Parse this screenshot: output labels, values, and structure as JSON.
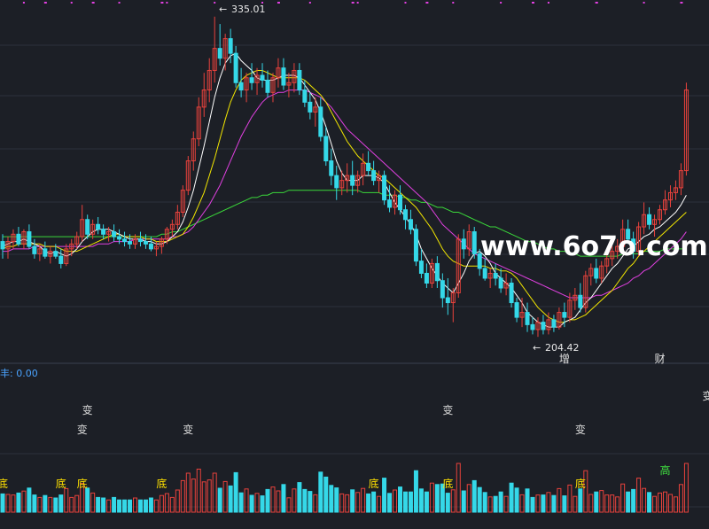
{
  "colors": {
    "background": "#1c1f26",
    "grid": "#2c313c",
    "up": "#e8423c",
    "down": "#35d8e8",
    "ma5": "#ffffff",
    "ma10": "#f2e600",
    "ma20": "#e040e0",
    "ma60": "#3ad83a",
    "divider": "#3a4150",
    "signal_text": "#d8d8d8",
    "low_text": "#ffe100",
    "high_text": "#40e040",
    "watermark": "#ffffff",
    "indicator_label": "#4aa3ff"
  },
  "watermark": "www.6o7o.com",
  "price_panel": {
    "high_label": "335.01",
    "low_label": "204.42",
    "event_labels": [
      {
        "text": "增",
        "candle": 106
      },
      {
        "text": "财",
        "candle": 124
      }
    ]
  },
  "indicator_panel": {
    "label": "丰: 0.00",
    "signal_labels": [
      {
        "text": "变",
        "candle": 16,
        "row": 1
      },
      {
        "text": "变",
        "candle": 15,
        "row": 2
      },
      {
        "text": "变",
        "candle": 35,
        "row": 2
      },
      {
        "text": "变",
        "candle": 84,
        "row": 1
      },
      {
        "text": "变",
        "candle": 109,
        "row": 2
      },
      {
        "text": "变",
        "candle": 133,
        "row": 3
      }
    ],
    "marker_labels": [
      {
        "text": "底",
        "candle": 0,
        "kind": "low"
      },
      {
        "text": "底",
        "candle": 11,
        "kind": "low"
      },
      {
        "text": "底",
        "candle": 15,
        "kind": "low"
      },
      {
        "text": "底",
        "candle": 30,
        "kind": "low"
      },
      {
        "text": "底",
        "candle": 70,
        "kind": "low"
      },
      {
        "text": "底",
        "candle": 84,
        "kind": "low"
      },
      {
        "text": "底",
        "candle": 109,
        "kind": "low"
      },
      {
        "text": "高",
        "candle": 125,
        "kind": "high"
      }
    ]
  },
  "chart_data": {
    "type": "candlestick",
    "series_names": [
      "MA5",
      "MA10",
      "MA20",
      "MA60"
    ],
    "price_range": [
      195,
      340
    ],
    "candles": [
      {
        "o": 243,
        "h": 246,
        "l": 236,
        "c": 240
      },
      {
        "o": 240,
        "h": 245,
        "l": 236,
        "c": 243
      },
      {
        "o": 243,
        "h": 248,
        "l": 240,
        "c": 246
      },
      {
        "o": 246,
        "h": 249,
        "l": 241,
        "c": 242
      },
      {
        "o": 242,
        "h": 248,
        "l": 240,
        "c": 247
      },
      {
        "o": 247,
        "h": 250,
        "l": 240,
        "c": 241
      },
      {
        "o": 241,
        "h": 244,
        "l": 236,
        "c": 238
      },
      {
        "o": 238,
        "h": 242,
        "l": 235,
        "c": 240
      },
      {
        "o": 240,
        "h": 243,
        "l": 236,
        "c": 237
      },
      {
        "o": 237,
        "h": 241,
        "l": 234,
        "c": 239
      },
      {
        "o": 239,
        "h": 242,
        "l": 236,
        "c": 237
      },
      {
        "o": 237,
        "h": 240,
        "l": 232,
        "c": 234
      },
      {
        "o": 234,
        "h": 242,
        "l": 233,
        "c": 240
      },
      {
        "o": 240,
        "h": 244,
        "l": 237,
        "c": 242
      },
      {
        "o": 242,
        "h": 247,
        "l": 240,
        "c": 245
      },
      {
        "o": 245,
        "h": 258,
        "l": 243,
        "c": 252
      },
      {
        "o": 252,
        "h": 254,
        "l": 244,
        "c": 246
      },
      {
        "o": 246,
        "h": 252,
        "l": 244,
        "c": 250
      },
      {
        "o": 250,
        "h": 253,
        "l": 246,
        "c": 248
      },
      {
        "o": 248,
        "h": 250,
        "l": 244,
        "c": 246
      },
      {
        "o": 246,
        "h": 249,
        "l": 243,
        "c": 247
      },
      {
        "o": 247,
        "h": 250,
        "l": 243,
        "c": 245
      },
      {
        "o": 245,
        "h": 248,
        "l": 242,
        "c": 244
      },
      {
        "o": 244,
        "h": 247,
        "l": 241,
        "c": 243
      },
      {
        "o": 243,
        "h": 246,
        "l": 240,
        "c": 242
      },
      {
        "o": 242,
        "h": 246,
        "l": 240,
        "c": 244
      },
      {
        "o": 244,
        "h": 247,
        "l": 241,
        "c": 243
      },
      {
        "o": 243,
        "h": 246,
        "l": 240,
        "c": 242
      },
      {
        "o": 242,
        "h": 245,
        "l": 239,
        "c": 240
      },
      {
        "o": 240,
        "h": 243,
        "l": 237,
        "c": 241
      },
      {
        "o": 241,
        "h": 245,
        "l": 238,
        "c": 244
      },
      {
        "o": 244,
        "h": 249,
        "l": 242,
        "c": 248
      },
      {
        "o": 248,
        "h": 252,
        "l": 245,
        "c": 250
      },
      {
        "o": 250,
        "h": 258,
        "l": 248,
        "c": 255
      },
      {
        "o": 255,
        "h": 266,
        "l": 253,
        "c": 264
      },
      {
        "o": 264,
        "h": 278,
        "l": 262,
        "c": 276
      },
      {
        "o": 276,
        "h": 288,
        "l": 272,
        "c": 285
      },
      {
        "o": 285,
        "h": 302,
        "l": 282,
        "c": 298
      },
      {
        "o": 298,
        "h": 312,
        "l": 294,
        "c": 305
      },
      {
        "o": 305,
        "h": 318,
        "l": 300,
        "c": 313
      },
      {
        "o": 313,
        "h": 335,
        "l": 308,
        "c": 322
      },
      {
        "o": 322,
        "h": 332,
        "l": 315,
        "c": 318
      },
      {
        "o": 318,
        "h": 328,
        "l": 313,
        "c": 326
      },
      {
        "o": 326,
        "h": 330,
        "l": 316,
        "c": 320
      },
      {
        "o": 320,
        "h": 323,
        "l": 306,
        "c": 308
      },
      {
        "o": 308,
        "h": 314,
        "l": 302,
        "c": 305
      },
      {
        "o": 305,
        "h": 312,
        "l": 300,
        "c": 310
      },
      {
        "o": 310,
        "h": 316,
        "l": 305,
        "c": 308
      },
      {
        "o": 308,
        "h": 314,
        "l": 303,
        "c": 311
      },
      {
        "o": 311,
        "h": 316,
        "l": 306,
        "c": 309
      },
      {
        "o": 309,
        "h": 313,
        "l": 302,
        "c": 304
      },
      {
        "o": 304,
        "h": 312,
        "l": 300,
        "c": 310
      },
      {
        "o": 310,
        "h": 318,
        "l": 306,
        "c": 314
      },
      {
        "o": 314,
        "h": 318,
        "l": 305,
        "c": 307
      },
      {
        "o": 307,
        "h": 312,
        "l": 302,
        "c": 308
      },
      {
        "o": 308,
        "h": 316,
        "l": 304,
        "c": 313
      },
      {
        "o": 313,
        "h": 316,
        "l": 303,
        "c": 305
      },
      {
        "o": 305,
        "h": 309,
        "l": 298,
        "c": 300
      },
      {
        "o": 300,
        "h": 304,
        "l": 293,
        "c": 296
      },
      {
        "o": 296,
        "h": 302,
        "l": 290,
        "c": 298
      },
      {
        "o": 298,
        "h": 302,
        "l": 284,
        "c": 286
      },
      {
        "o": 286,
        "h": 290,
        "l": 274,
        "c": 276
      },
      {
        "o": 276,
        "h": 281,
        "l": 266,
        "c": 270
      },
      {
        "o": 270,
        "h": 274,
        "l": 260,
        "c": 265
      },
      {
        "o": 265,
        "h": 272,
        "l": 262,
        "c": 268
      },
      {
        "o": 268,
        "h": 275,
        "l": 263,
        "c": 270
      },
      {
        "o": 270,
        "h": 276,
        "l": 262,
        "c": 266
      },
      {
        "o": 266,
        "h": 272,
        "l": 263,
        "c": 270
      },
      {
        "o": 270,
        "h": 279,
        "l": 266,
        "c": 275
      },
      {
        "o": 275,
        "h": 280,
        "l": 270,
        "c": 272
      },
      {
        "o": 272,
        "h": 276,
        "l": 266,
        "c": 268
      },
      {
        "o": 268,
        "h": 272,
        "l": 263,
        "c": 270
      },
      {
        "o": 270,
        "h": 272,
        "l": 258,
        "c": 260
      },
      {
        "o": 260,
        "h": 266,
        "l": 255,
        "c": 257
      },
      {
        "o": 257,
        "h": 264,
        "l": 254,
        "c": 262
      },
      {
        "o": 262,
        "h": 266,
        "l": 254,
        "c": 256
      },
      {
        "o": 256,
        "h": 258,
        "l": 248,
        "c": 252
      },
      {
        "o": 252,
        "h": 256,
        "l": 246,
        "c": 248
      },
      {
        "o": 248,
        "h": 250,
        "l": 233,
        "c": 235
      },
      {
        "o": 235,
        "h": 240,
        "l": 228,
        "c": 230
      },
      {
        "o": 230,
        "h": 234,
        "l": 224,
        "c": 226
      },
      {
        "o": 226,
        "h": 236,
        "l": 224,
        "c": 234
      },
      {
        "o": 234,
        "h": 237,
        "l": 224,
        "c": 227
      },
      {
        "o": 227,
        "h": 230,
        "l": 216,
        "c": 220
      },
      {
        "o": 220,
        "h": 228,
        "l": 213,
        "c": 218
      },
      {
        "o": 218,
        "h": 224,
        "l": 210,
        "c": 222
      },
      {
        "o": 222,
        "h": 246,
        "l": 220,
        "c": 244
      },
      {
        "o": 244,
        "h": 248,
        "l": 236,
        "c": 240
      },
      {
        "o": 240,
        "h": 250,
        "l": 237,
        "c": 247
      },
      {
        "o": 247,
        "h": 249,
        "l": 236,
        "c": 238
      },
      {
        "o": 238,
        "h": 240,
        "l": 229,
        "c": 232
      },
      {
        "o": 232,
        "h": 236,
        "l": 227,
        "c": 228
      },
      {
        "o": 228,
        "h": 232,
        "l": 224,
        "c": 230
      },
      {
        "o": 230,
        "h": 234,
        "l": 225,
        "c": 228
      },
      {
        "o": 228,
        "h": 232,
        "l": 222,
        "c": 224
      },
      {
        "o": 224,
        "h": 230,
        "l": 221,
        "c": 226
      },
      {
        "o": 226,
        "h": 228,
        "l": 216,
        "c": 218
      },
      {
        "o": 218,
        "h": 220,
        "l": 210,
        "c": 212
      },
      {
        "o": 212,
        "h": 220,
        "l": 208,
        "c": 214
      },
      {
        "o": 214,
        "h": 218,
        "l": 206,
        "c": 209
      },
      {
        "o": 209,
        "h": 212,
        "l": 205,
        "c": 207
      },
      {
        "o": 207,
        "h": 212,
        "l": 204,
        "c": 210
      },
      {
        "o": 210,
        "h": 213,
        "l": 205,
        "c": 207
      },
      {
        "o": 207,
        "h": 214,
        "l": 205,
        "c": 211
      },
      {
        "o": 211,
        "h": 213,
        "l": 206,
        "c": 208
      },
      {
        "o": 208,
        "h": 216,
        "l": 207,
        "c": 214
      },
      {
        "o": 214,
        "h": 218,
        "l": 208,
        "c": 212
      },
      {
        "o": 212,
        "h": 222,
        "l": 210,
        "c": 219
      },
      {
        "o": 219,
        "h": 224,
        "l": 215,
        "c": 221
      },
      {
        "o": 221,
        "h": 226,
        "l": 214,
        "c": 216
      },
      {
        "o": 216,
        "h": 231,
        "l": 214,
        "c": 229
      },
      {
        "o": 229,
        "h": 234,
        "l": 225,
        "c": 232
      },
      {
        "o": 232,
        "h": 236,
        "l": 226,
        "c": 228
      },
      {
        "o": 228,
        "h": 235,
        "l": 226,
        "c": 233
      },
      {
        "o": 233,
        "h": 238,
        "l": 230,
        "c": 236
      },
      {
        "o": 236,
        "h": 241,
        "l": 233,
        "c": 239
      },
      {
        "o": 239,
        "h": 244,
        "l": 236,
        "c": 241
      },
      {
        "o": 241,
        "h": 252,
        "l": 238,
        "c": 248
      },
      {
        "o": 248,
        "h": 252,
        "l": 242,
        "c": 244
      },
      {
        "o": 244,
        "h": 247,
        "l": 236,
        "c": 239
      },
      {
        "o": 239,
        "h": 251,
        "l": 237,
        "c": 249
      },
      {
        "o": 249,
        "h": 259,
        "l": 246,
        "c": 254
      },
      {
        "o": 254,
        "h": 257,
        "l": 248,
        "c": 250
      },
      {
        "o": 250,
        "h": 254,
        "l": 245,
        "c": 252
      },
      {
        "o": 252,
        "h": 258,
        "l": 250,
        "c": 256
      },
      {
        "o": 256,
        "h": 264,
        "l": 254,
        "c": 260
      },
      {
        "o": 260,
        "h": 266,
        "l": 257,
        "c": 263
      },
      {
        "o": 263,
        "h": 268,
        "l": 260,
        "c": 265
      },
      {
        "o": 265,
        "h": 275,
        "l": 262,
        "c": 272
      },
      {
        "o": 272,
        "h": 308,
        "l": 270,
        "c": 305
      }
    ],
    "ma5": [
      241,
      242,
      243,
      243,
      244,
      243,
      242,
      241,
      239,
      238,
      239,
      238,
      237,
      238,
      240,
      243,
      245,
      247,
      248,
      248,
      248,
      247,
      246,
      245,
      244,
      244,
      244,
      243,
      243,
      242,
      242,
      243,
      245,
      247,
      251,
      257,
      264,
      273,
      282,
      292,
      302,
      310,
      316,
      319,
      320,
      317,
      315,
      313,
      310,
      309,
      309,
      309,
      310,
      311,
      311,
      311,
      310,
      307,
      304,
      301,
      296,
      290,
      283,
      276,
      271,
      268,
      268,
      268,
      270,
      270,
      270,
      269,
      267,
      263,
      259,
      256,
      253,
      250,
      246,
      240,
      236,
      232,
      229,
      226,
      224,
      222,
      226,
      230,
      235,
      238,
      239,
      237,
      234,
      230,
      228,
      226,
      224,
      221,
      218,
      214,
      212,
      210,
      209,
      208,
      208,
      208,
      210,
      211,
      212,
      215,
      218,
      220,
      223,
      226,
      229,
      232,
      234,
      237,
      240,
      241,
      243,
      245,
      246,
      248,
      249,
      251,
      253,
      255,
      258,
      262
    ],
    "ma10": [
      240,
      241,
      241,
      242,
      242,
      242,
      242,
      242,
      241,
      241,
      241,
      240,
      239,
      239,
      239,
      240,
      241,
      242,
      243,
      244,
      245,
      246,
      246,
      245,
      245,
      245,
      245,
      244,
      244,
      243,
      243,
      243,
      244,
      245,
      246,
      249,
      253,
      258,
      263,
      270,
      277,
      285,
      293,
      300,
      305,
      309,
      311,
      312,
      313,
      313,
      312,
      311,
      310,
      310,
      310,
      310,
      310,
      309,
      307,
      305,
      303,
      300,
      296,
      292,
      288,
      284,
      281,
      278,
      276,
      274,
      272,
      270,
      269,
      267,
      265,
      263,
      261,
      259,
      257,
      254,
      251,
      248,
      244,
      240,
      237,
      235,
      234,
      233,
      233,
      233,
      233,
      233,
      232,
      232,
      231,
      231,
      230,
      228,
      225,
      222,
      219,
      216,
      214,
      212,
      211,
      210,
      210,
      211,
      211,
      212,
      213,
      215,
      217,
      219,
      221,
      223,
      226,
      229,
      232,
      234,
      237,
      239,
      241,
      243,
      245,
      247,
      249,
      251,
      253,
      255
    ],
    "ma20": [
      239,
      239,
      240,
      240,
      240,
      240,
      241,
      241,
      241,
      241,
      241,
      241,
      241,
      241,
      241,
      241,
      241,
      241,
      242,
      242,
      242,
      243,
      243,
      243,
      243,
      244,
      244,
      244,
      244,
      244,
      244,
      244,
      245,
      245,
      246,
      247,
      249,
      252,
      255,
      258,
      262,
      266,
      271,
      276,
      281,
      286,
      290,
      294,
      297,
      300,
      302,
      303,
      304,
      304,
      305,
      305,
      305,
      305,
      304,
      303,
      302,
      300,
      298,
      295,
      292,
      289,
      287,
      285,
      283,
      281,
      279,
      277,
      275,
      273,
      271,
      269,
      267,
      265,
      263,
      261,
      259,
      256,
      253,
      250,
      248,
      246,
      244,
      242,
      240,
      238,
      237,
      236,
      235,
      234,
      233,
      232,
      231,
      230,
      229,
      228,
      227,
      226,
      225,
      224,
      223,
      222,
      221,
      220,
      220,
      220,
      220,
      220,
      221,
      221,
      222,
      223,
      224,
      225,
      226,
      228,
      229,
      231,
      232,
      234,
      236,
      238,
      240,
      242,
      244,
      247
    ],
    "ma60": [
      245,
      245,
      245,
      245,
      245,
      245,
      245,
      245,
      245,
      245,
      245,
      245,
      245,
      245,
      245,
      245,
      245,
      245,
      245,
      245,
      245,
      245,
      245,
      245,
      245,
      245,
      245,
      245,
      245,
      245,
      246,
      246,
      247,
      247,
      248,
      249,
      250,
      251,
      252,
      253,
      254,
      255,
      256,
      257,
      258,
      259,
      260,
      261,
      261,
      262,
      262,
      263,
      263,
      263,
      264,
      264,
      264,
      264,
      264,
      264,
      264,
      264,
      264,
      264,
      264,
      264,
      264,
      264,
      263,
      263,
      263,
      263,
      262,
      262,
      262,
      261,
      261,
      260,
      260,
      259,
      259,
      258,
      257,
      257,
      256,
      255,
      255,
      254,
      253,
      252,
      251,
      250,
      249,
      249,
      248,
      247,
      246,
      245,
      244,
      243,
      243,
      242,
      241,
      240,
      240,
      239,
      239,
      238,
      238,
      237,
      237,
      237,
      237,
      237,
      237,
      237,
      237,
      238,
      238,
      238,
      238,
      239,
      239,
      239,
      239,
      240,
      240,
      240,
      240,
      240
    ]
  }
}
